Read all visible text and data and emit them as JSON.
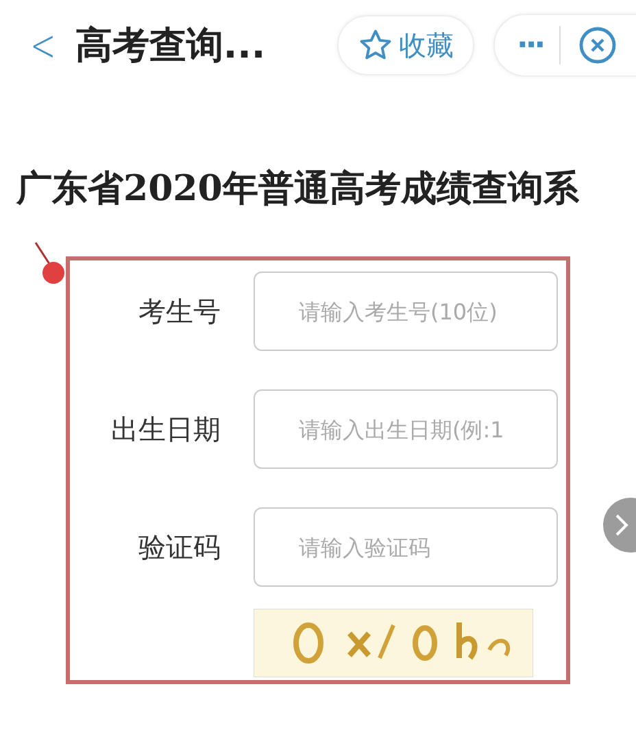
{
  "header": {
    "back": "<",
    "title": "高考查询...",
    "favorite": "收藏",
    "more": "···"
  },
  "heading": "广东省2020年普通高考成绩查询系",
  "form": {
    "fields": [
      {
        "label": "考生号",
        "placeholder": "请输入考生号(10位)"
      },
      {
        "label": "出生日期",
        "placeholder": "请输入出生日期(例:1"
      },
      {
        "label": "验证码",
        "placeholder": "请输入验证码"
      }
    ]
  }
}
